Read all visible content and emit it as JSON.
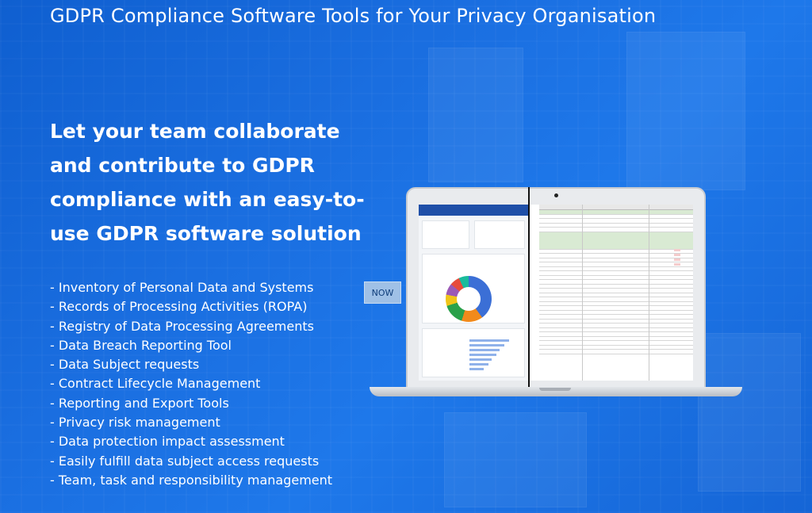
{
  "page": {
    "title": "GDPR Compliance Software Tools for Your Privacy Organisation",
    "headline": "Let your team collaborate and contribute to GDPR compliance with an easy-to-use GDPR software solution"
  },
  "features": [
    "- Inventory of Personal Data and Systems",
    "- Records of Processing Activities (ROPA)",
    "- Registry of Data Processing Agreements",
    "- Data Breach Reporting Tool",
    "- Data Subject requests",
    "- Contract Lifecycle Management",
    "- Reporting and Export Tools",
    "- Privacy risk management",
    "- Data protection impact assessment",
    "- Easily fulfill data subject access requests",
    "- Team, task and responsibility management"
  ],
  "compare": {
    "now_label": "NOW"
  },
  "colors": {
    "background": "#1a6ee0",
    "text": "#ffffff",
    "now_button": "#9fc0e6"
  }
}
